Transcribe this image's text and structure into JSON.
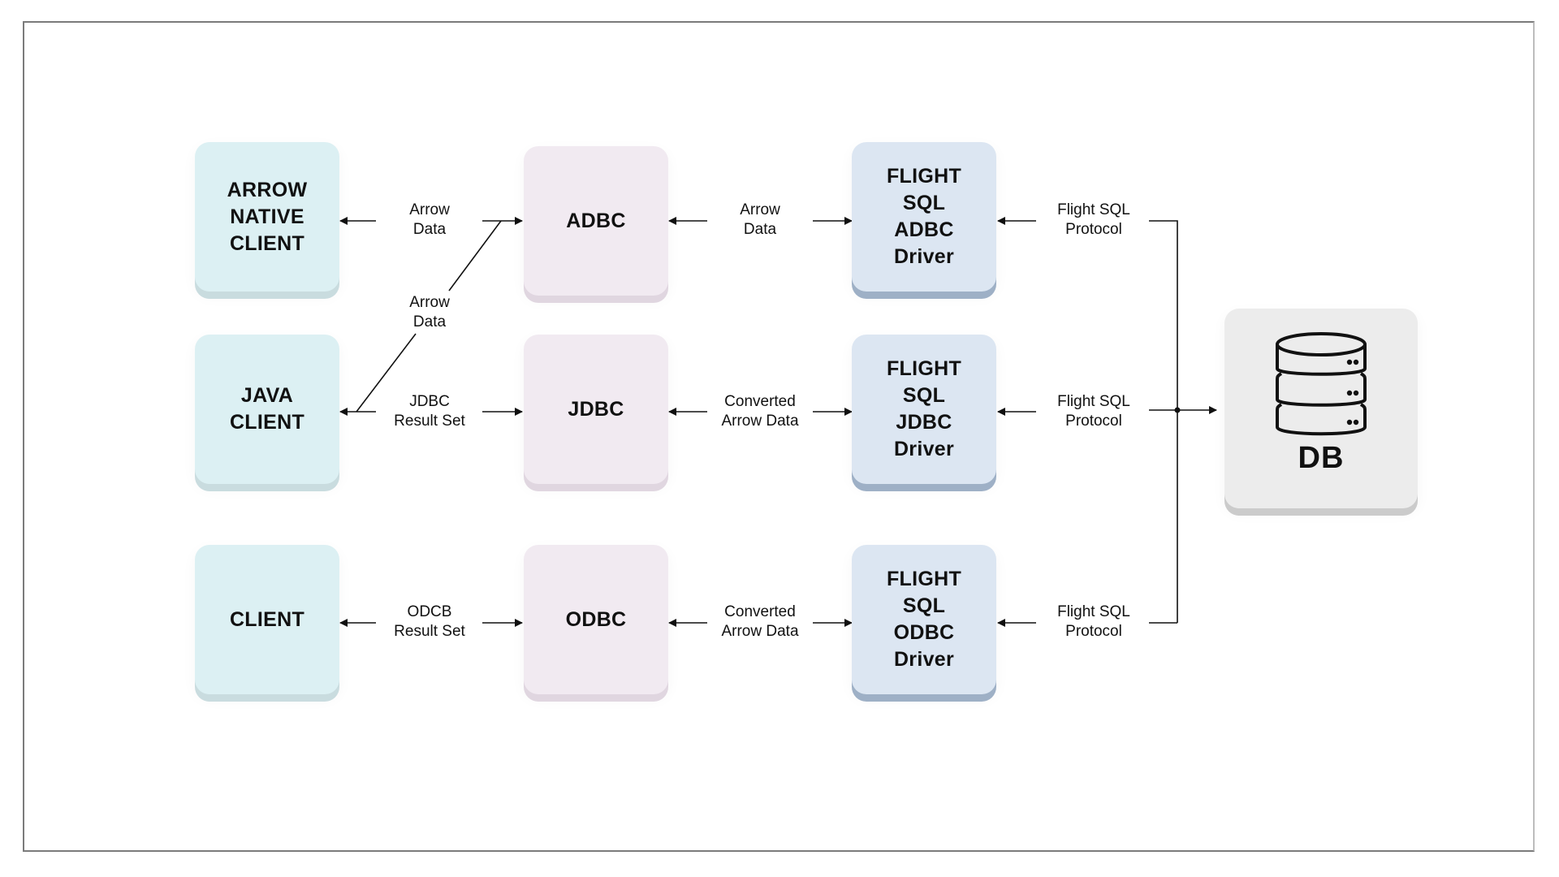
{
  "diagram": {
    "nodes": {
      "arrow_native_client": "ARROW\nNATIVE\nCLIENT",
      "java_client": "JAVA\nCLIENT",
      "client": "CLIENT",
      "adbc": "ADBC",
      "jdbc": "JDBC",
      "odbc": "ODBC",
      "flight_adbc": "FLIGHT\nSQL\nADBC\nDriver",
      "flight_jdbc": "FLIGHT\nSQL\nJDBC\nDriver",
      "flight_odbc": "FLIGHT\nSQL\nODBC\nDriver",
      "db": "DB"
    },
    "edges": {
      "arrow_native_to_adbc": "Arrow\nData",
      "java_to_adbc": "Arrow\nData",
      "java_to_jdbc": "JDBC\nResult Set",
      "client_to_odbc": "ODCB\nResult Set",
      "adbc_to_flight": "Arrow\nData",
      "jdbc_to_flight": "Converted\nArrow Data",
      "odbc_to_flight": "Converted\nArrow Data",
      "flight_adbc_protocol": "Flight SQL\nProtocol",
      "flight_jdbc_protocol": "Flight SQL\nProtocol",
      "flight_odbc_protocol": "Flight SQL\nProtocol"
    },
    "icons": {
      "db": "database-icon"
    },
    "colors": {
      "client_fill": "#dcf0f3",
      "middle_fill": "#f1eaf1",
      "flight_fill": "#dce6f2",
      "db_fill": "#ececec"
    }
  }
}
